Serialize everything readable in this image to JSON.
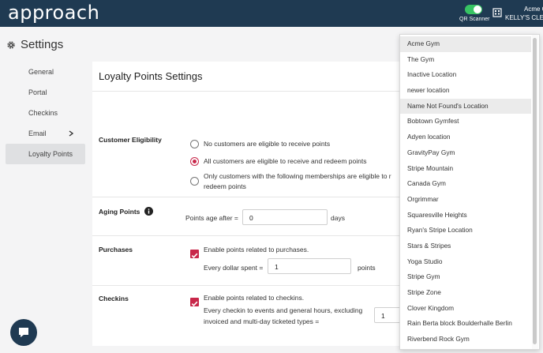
{
  "brand": {
    "logo_text": "approach",
    "qr_label": "QR Scanner",
    "account_line1": "Acme G",
    "account_line2": "KELLY'S CLEAR"
  },
  "page": {
    "heading": "Settings"
  },
  "nav": [
    {
      "label": "General"
    },
    {
      "label": "Portal"
    },
    {
      "label": "Checkins"
    },
    {
      "label": "Email"
    },
    {
      "label": "Loyalty Points"
    }
  ],
  "loyalty": {
    "title": "Loyalty Points Settings",
    "eligibility": {
      "label": "Customer Eligibility",
      "options": [
        {
          "text": "No customers are eligible to receive points",
          "selected": false
        },
        {
          "text": "All customers are eligible to receive and redeem points",
          "selected": true
        },
        {
          "text_line1": "Only customers with the following memberships are eligible to r",
          "text_line2": "redeem points",
          "selected": false
        }
      ]
    },
    "aging": {
      "label": "Aging Points",
      "prefix": "Points age after =",
      "value": "0",
      "unit": "days"
    },
    "purchases": {
      "label": "Purchases",
      "checkbox": "Enable points related to purchases.",
      "prefix": "Every dollar spent =",
      "value": "1",
      "unit": "points"
    },
    "checkins": {
      "label": "Checkins",
      "checkbox": "Enable points related to checkins.",
      "line1": "Every checkin to events and general hours, excluding",
      "line2": "invoiced and multi-day ticketed types =",
      "value": "1"
    }
  },
  "dropdown": {
    "items": [
      "Acme Gym",
      "The Gym",
      "Inactive Location",
      "newer location",
      "Name Not Found's Location",
      "Bobtown Gymfest",
      "Adyen location",
      "GravityPay Gym",
      "Stripe Mountain",
      "Canada Gym",
      "Orgrimmar",
      "Squaresville Heights",
      "Ryan's Stripe Location",
      "Stars & Stripes",
      "Yoga Studio",
      "Stripe Gym",
      "Stripe Zone",
      "Clover Kingdom",
      "Rain Berta block Boulderhalle Berlin",
      "Riverbend Rock Gym"
    ]
  }
}
